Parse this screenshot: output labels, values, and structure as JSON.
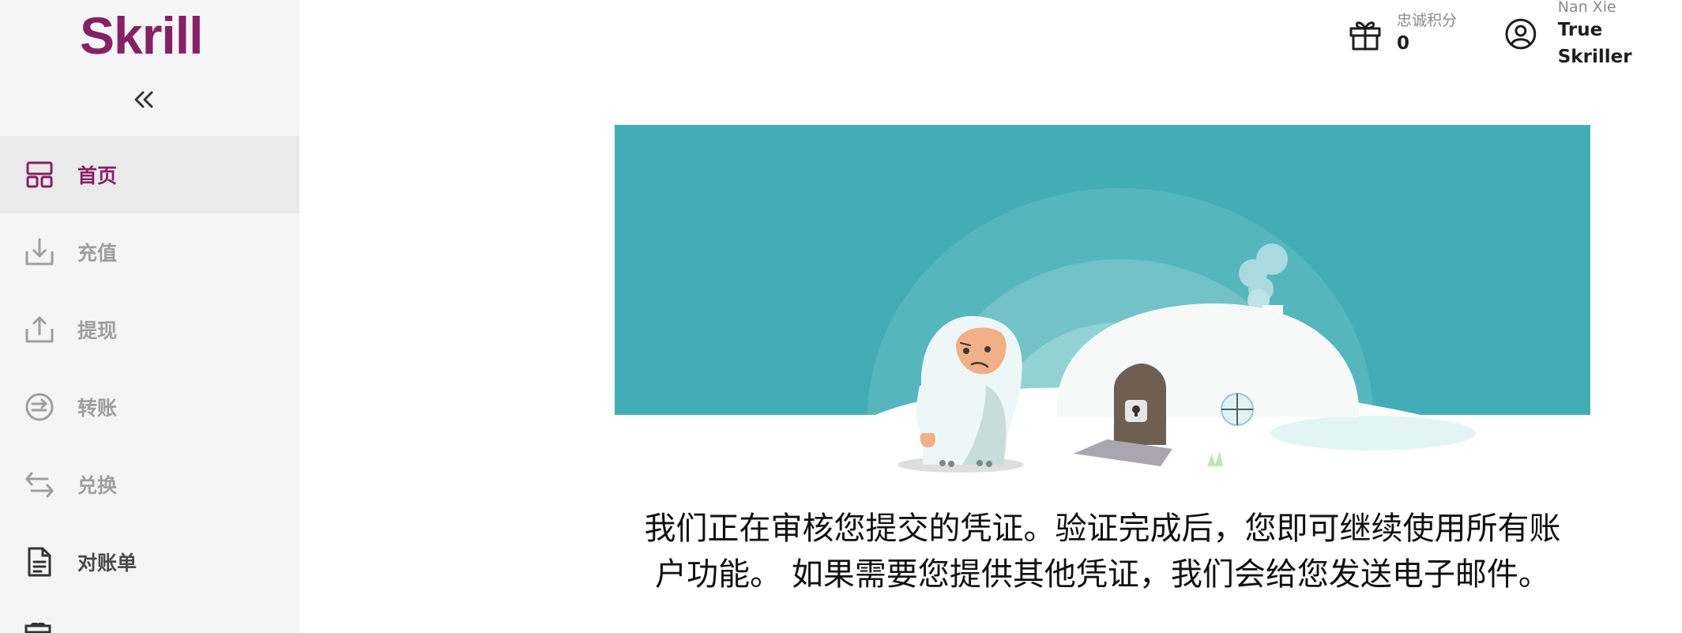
{
  "brand": {
    "name": "Skrill",
    "color": "#862165"
  },
  "sidebar": {
    "collapse_icon": "double-chevron-left-icon",
    "items": [
      {
        "label": "首页",
        "icon": "dashboard-icon",
        "active": true
      },
      {
        "label": "充值",
        "icon": "deposit-icon",
        "active": false
      },
      {
        "label": "提现",
        "icon": "withdraw-icon",
        "active": false
      },
      {
        "label": "转账",
        "icon": "transfer-icon",
        "active": false
      },
      {
        "label": "兑换",
        "icon": "exchange-icon",
        "active": false
      },
      {
        "label": "对账单",
        "icon": "statement-icon",
        "active": false
      }
    ]
  },
  "header": {
    "loyalty": {
      "label": "忠诚积分",
      "value": "0",
      "icon": "gift-icon"
    },
    "account": {
      "user_name": "Nan Xie",
      "status": "True Skriller",
      "icon": "user-circle-icon"
    }
  },
  "main": {
    "illustration": "yeti-igloo-illustration",
    "message_line1": "我们正在审核您提交的凭证。验证完成后，您即可继续使用所有账",
    "message_line2": "户功能。 如果需要您提供其他凭证，我们会给您发送电子邮件。"
  },
  "colors": {
    "accent": "#862165",
    "banner": "#43adb6"
  }
}
